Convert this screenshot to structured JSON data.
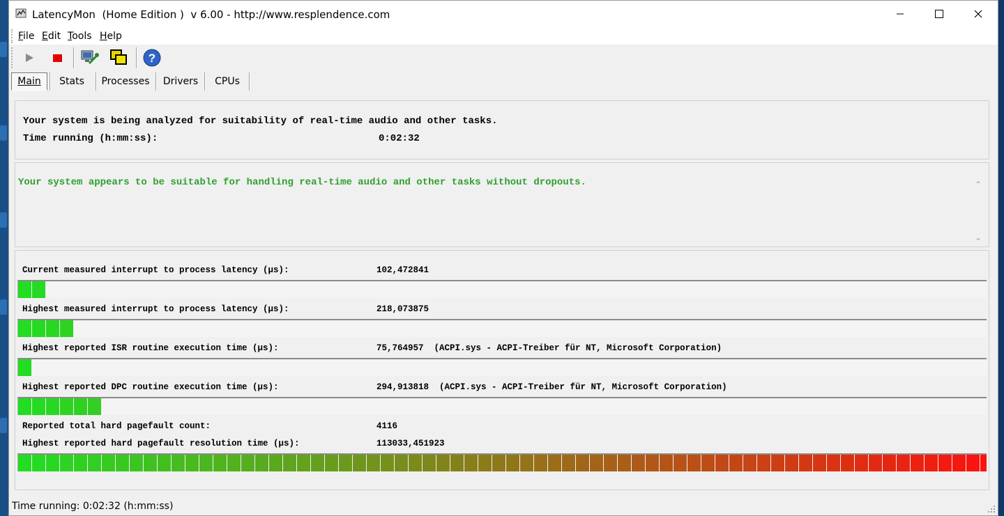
{
  "window": {
    "title": "LatencyMon  (Home Edition )  v 6.00 - http://www.resplendence.com",
    "minimize_icon": "minimize-icon",
    "maximize_icon": "maximize-icon",
    "close_icon": "close-icon"
  },
  "menu": {
    "file_rest": "ile",
    "file_key": "F",
    "edit_rest": "dit",
    "edit_key": "E",
    "tools_rest": "ools",
    "tools_key": "T",
    "help_rest": "elp",
    "help_key": "H"
  },
  "toolbar": {
    "items": [
      "play-icon",
      "stop-icon",
      "monitor-wrench-icon",
      "windows-icon",
      "help-icon"
    ]
  },
  "tabs": [
    "Main",
    "Stats",
    "Processes",
    "Drivers",
    "CPUs"
  ],
  "summary": {
    "analyzing_text": "Your system is being analyzed for suitability of real-time audio and other tasks.",
    "time_label": "Time running (h:mm:ss):",
    "time_value": "0:02:32"
  },
  "verdict": {
    "text": "Your system appears to be suitable for handling real-time audio and other tasks without dropouts.",
    "color": "#2fa02f"
  },
  "metrics": {
    "current_latency": {
      "label": "Current measured interrupt to process latency (µs):",
      "value": "102,472841",
      "level": 0.027
    },
    "highest_latency": {
      "label": "Highest measured interrupt to process latency (µs):",
      "value": "218,073875",
      "level": 0.056
    },
    "isr": {
      "label": "Highest reported ISR routine execution time (µs):",
      "value": "75,764957  (ACPI.sys - ACPI-Treiber für NT, Microsoft Corporation)",
      "level": 0.013
    },
    "dpc": {
      "label": "Highest reported DPC routine execution time (µs):",
      "value": "294,913818  (ACPI.sys - ACPI-Treiber für NT, Microsoft Corporation)",
      "level": 0.085
    },
    "pagefault_count": {
      "label": "Reported total hard pagefault count:",
      "value": "4116"
    },
    "pagefault_time": {
      "label": "Highest reported hard pagefault resolution time (µs):",
      "value": "113033,451923",
      "level": 1.0
    }
  },
  "colors": {
    "bar_green": "#22dd22",
    "bar_red": "#ff1010"
  },
  "statusbar": {
    "text": "Time running: 0:02:32  (h:mm:ss)"
  }
}
